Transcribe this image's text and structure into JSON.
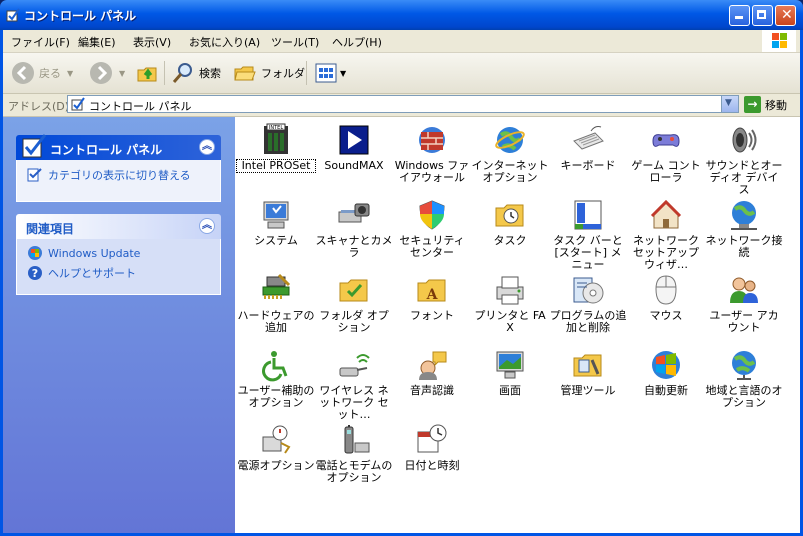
{
  "window": {
    "title": "コントロール パネル"
  },
  "menu": [
    "ファイル(F)",
    "編集(E)",
    "表示(V)",
    "お気に入り(A)",
    "ツール(T)",
    "ヘルプ(H)"
  ],
  "toolbar": {
    "back": "戻る",
    "search": "検索",
    "folders": "フォルダ"
  },
  "address": {
    "label": "アドレス(D)",
    "value": "コントロール パネル",
    "go": "移動"
  },
  "taskpane": {
    "panel1": {
      "title": "コントロール パネル",
      "link": "カテゴリの表示に切り替える"
    },
    "panel2": {
      "title": "関連項目",
      "links": [
        "Windows Update",
        "ヘルプとサポート"
      ]
    }
  },
  "items": [
    {
      "label": "Intel PROSet",
      "icon": "intel-icon"
    },
    {
      "label": "SoundMAX",
      "icon": "soundmax-icon"
    },
    {
      "label": "Windows ファイアウォール",
      "icon": "firewall-icon"
    },
    {
      "label": "インターネット オプション",
      "icon": "globe-icon"
    },
    {
      "label": "キーボード",
      "icon": "keyboard-icon"
    },
    {
      "label": "ゲーム コントローラ",
      "icon": "gamepad-icon"
    },
    {
      "label": "サウンドとオーディオ デバイス",
      "icon": "speaker-icon"
    },
    {
      "label": "システム",
      "icon": "computer-icon"
    },
    {
      "label": "スキャナとカメラ",
      "icon": "scanner-icon"
    },
    {
      "label": "セキュリティ センター",
      "icon": "shield-icon"
    },
    {
      "label": "タスク",
      "icon": "tasks-folder-icon"
    },
    {
      "label": "タスク バーと [スタート] メニュー",
      "icon": "taskbar-icon"
    },
    {
      "label": "ネットワーク セットアップ ウィザ…",
      "icon": "house-icon"
    },
    {
      "label": "ネットワーク接続",
      "icon": "network-icon"
    },
    {
      "label": "ハードウェアの追加",
      "icon": "hardware-icon"
    },
    {
      "label": "フォルダ オプション",
      "icon": "folder-icon"
    },
    {
      "label": "フォント",
      "icon": "font-folder-icon"
    },
    {
      "label": "プリンタと FAX",
      "icon": "printer-icon"
    },
    {
      "label": "プログラムの追加と削除",
      "icon": "programs-icon"
    },
    {
      "label": "マウス",
      "icon": "mouse-icon"
    },
    {
      "label": "ユーザー アカウント",
      "icon": "users-icon"
    },
    {
      "label": "ユーザー補助のオプション",
      "icon": "accessibility-icon"
    },
    {
      "label": "ワイヤレス ネットワーク セット…",
      "icon": "wireless-icon"
    },
    {
      "label": "音声認識",
      "icon": "speech-icon"
    },
    {
      "label": "画面",
      "icon": "display-icon"
    },
    {
      "label": "管理ツール",
      "icon": "admin-tools-icon"
    },
    {
      "label": "自動更新",
      "icon": "windows-update-icon"
    },
    {
      "label": "地域と言語のオプション",
      "icon": "region-globe-icon"
    },
    {
      "label": "電源オプション",
      "icon": "power-icon"
    },
    {
      "label": "電話とモデムのオプション",
      "icon": "phone-icon"
    },
    {
      "label": "日付と時刻",
      "icon": "datetime-icon"
    }
  ]
}
